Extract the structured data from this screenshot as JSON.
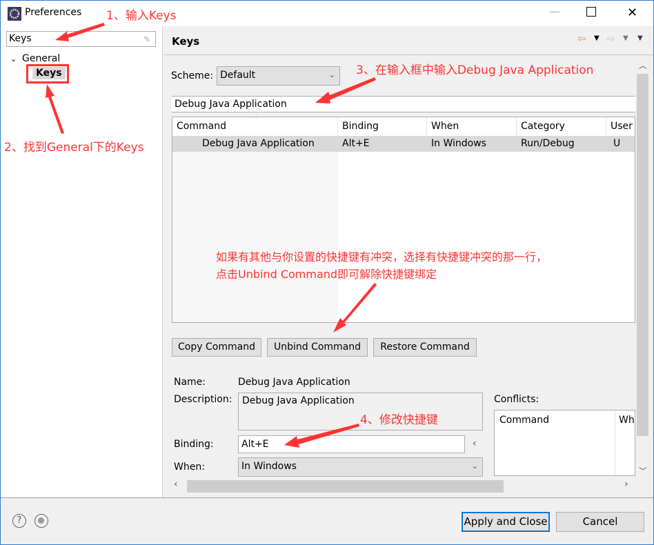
{
  "window": {
    "title": "Preferences",
    "minimize": "—",
    "maximize": "☐",
    "close": "✕"
  },
  "sidebar": {
    "search_value": "Keys",
    "tree": [
      {
        "label": "General",
        "expanded": true,
        "children": [
          {
            "label": "Keys",
            "selected": true
          }
        ]
      }
    ]
  },
  "page": {
    "title": "Keys",
    "scheme_label": "Scheme:",
    "scheme_value": "Default",
    "filter_value": "Debug Java Application",
    "table": {
      "columns": [
        "Command",
        "Binding",
        "When",
        "Category",
        "User"
      ],
      "rows": [
        {
          "Command": "Debug Java Application",
          "Binding": "Alt+E",
          "When": "In Windows",
          "Category": "Run/Debug",
          "User": "U"
        }
      ]
    },
    "buttons": {
      "copy": "Copy Command",
      "unbind": "Unbind Command",
      "restore": "Restore Command"
    },
    "details": {
      "name_label": "Name:",
      "name_value": "Debug Java Application",
      "description_label": "Description:",
      "description_value": "Debug Java Application",
      "binding_label": "Binding:",
      "binding_value": "Alt+E",
      "when_label": "When:",
      "when_value": "In Windows",
      "conflicts_label": "Conflicts:",
      "conflicts_columns": [
        "Command",
        "Wh"
      ]
    }
  },
  "footer": {
    "apply_close": "Apply and Close",
    "cancel": "Cancel"
  },
  "annotations": {
    "step1": "1、输入Keys",
    "step2": "2、找到General下的Keys",
    "step3": "3、在输入框中输入Debug Java Application",
    "note_line1": "如果有其他与你设置的快捷键有冲突，选择有快捷键冲突的那一行，",
    "note_line2": "点击Unbind Command即可解除快捷键绑定",
    "step4": "4、修改快捷键",
    "color": "#ff3333"
  }
}
